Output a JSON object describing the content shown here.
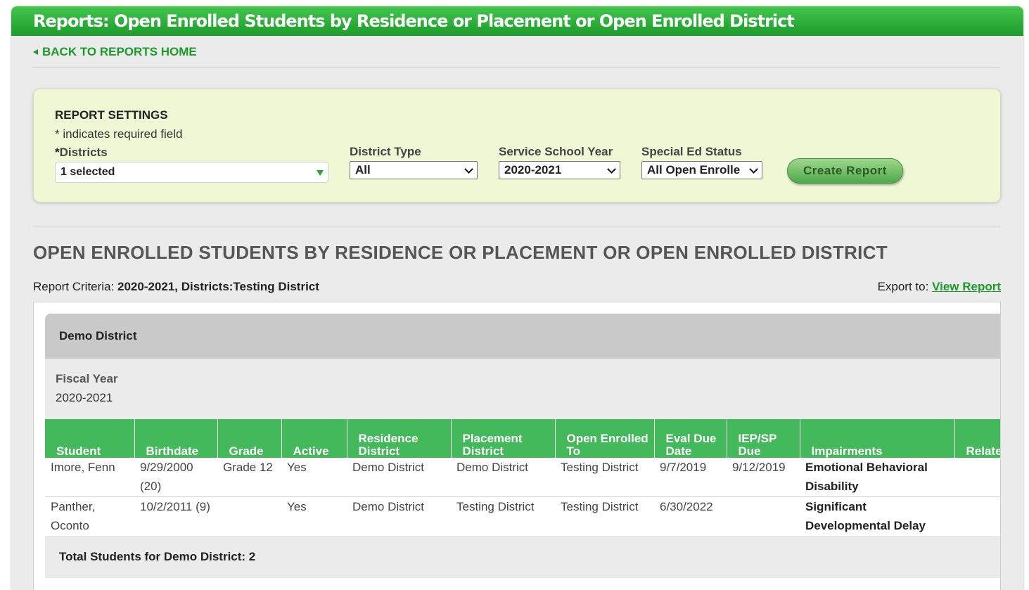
{
  "title": "Reports: Open Enrolled Students by Residence or Placement or Open Enrolled District",
  "back_link": "BACK TO REPORTS HOME",
  "settings": {
    "heading": "REPORT SETTINGS",
    "required_note": "* indicates required field",
    "districts_label": "Districts",
    "districts_required_marker": "*",
    "districts_value": "1 selected",
    "district_type_label": "District Type",
    "district_type_value": "All",
    "school_year_label": "Service School Year",
    "school_year_value": "2020-2021",
    "sped_status_label": "Special Ed Status",
    "sped_status_value": "All Open Enrolle",
    "create_button": "Create Report"
  },
  "report": {
    "title": "OPEN ENROLLED STUDENTS BY RESIDENCE OR PLACEMENT OR OPEN ENROLLED DISTRICT",
    "criteria_label": "Report Criteria:",
    "criteria_value": "2020-2021, Districts:Testing District",
    "export_label": "Export to:",
    "export_link": "View Report",
    "district_name": "Demo District",
    "fiscal_year_label": "Fiscal Year",
    "fiscal_year_value": "2020-2021",
    "columns": [
      "Student",
      "Birthdate",
      "Grade",
      "Active",
      "Residence District",
      "Placement District",
      "Open Enrolled To",
      "Eval Due Date",
      "IEP/SP Due",
      "Impairments",
      "Related Services"
    ],
    "rows": [
      {
        "student": "Imore, Fenn",
        "birthdate": "9/29/2000 (20)",
        "grade": "Grade 12",
        "active": "Yes",
        "residence": "Demo District",
        "placement": "Demo District",
        "open_enrolled_to": "Testing District",
        "eval_due": "9/7/2019",
        "iep_due": "9/12/2019",
        "impairments": "Emotional Behavioral Disability",
        "related": ""
      },
      {
        "student": "Panther, Oconto",
        "birthdate": "10/2/2011 (9)",
        "grade": "",
        "active": "Yes",
        "residence": "Demo District",
        "placement": "Testing District",
        "open_enrolled_to": "Testing District",
        "eval_due": "6/30/2022",
        "iep_due": "",
        "impairments": "Significant Developmental Delay",
        "related": ""
      }
    ],
    "total": "Total Students for Demo District: 2"
  },
  "colors": {
    "brand_green": "#1e9a2c",
    "header_green": "#44b95c",
    "settings_bg": "#eef8d5"
  }
}
